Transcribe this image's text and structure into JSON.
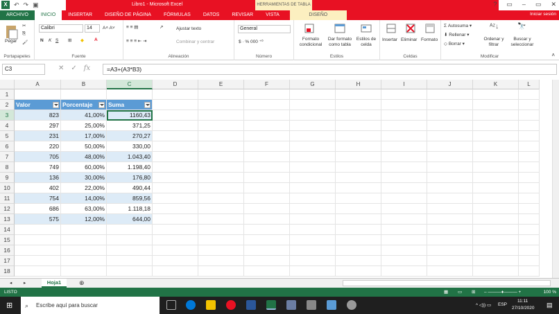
{
  "title": {
    "text": "Libro1 - Microsoft Excel",
    "context": "HERRAMIENTAS DE TABLA",
    "signin": "Iniciar sesión"
  },
  "tabs": [
    "ARCHIVO",
    "INICIO",
    "INSERTAR",
    "DISEÑO DE PÁGINA",
    "FÓRMULAS",
    "DATOS",
    "REVISAR",
    "VISTA",
    "DISEÑO"
  ],
  "ribbon": {
    "paste": "Pegar",
    "font": "Calibri",
    "size": "14",
    "wrap": "Ajustar texto",
    "merge": "Combinar y centrar",
    "numfmt": "General",
    "cond": "Formato condicional",
    "astable": "Dar formato como tabla",
    "styles": "Estilos de celda",
    "insert": "Insertar",
    "delete": "Eliminar",
    "format": "Formato",
    "autosum": "Autosuma",
    "fill": "Rellenar",
    "clear": "Borrar",
    "sort": "Ordenar y filtrar",
    "find": "Buscar y seleccionar",
    "groups": [
      "Portapapeles",
      "Fuente",
      "Alineación",
      "Número",
      "Estilos",
      "Celdas",
      "Modificar"
    ]
  },
  "formula_bar": {
    "namebox": "C3",
    "fx": "fx",
    "formula": "=A3+(A3*B3)"
  },
  "columns": [
    "A",
    "B",
    "C",
    "D",
    "E",
    "F",
    "G",
    "H",
    "I",
    "J",
    "K",
    "L"
  ],
  "rows": [
    "1",
    "2",
    "3",
    "4",
    "5",
    "6",
    "7",
    "8",
    "9",
    "10",
    "11",
    "12",
    "13",
    "14",
    "15",
    "16",
    "17",
    "18"
  ],
  "table": {
    "headers": [
      "Valor",
      "Porcentaje",
      "Suma"
    ],
    "data": [
      [
        "823",
        "41,00%",
        "1160,43"
      ],
      [
        "297",
        "25,00%",
        "371,25"
      ],
      [
        "231",
        "17,00%",
        "270,27"
      ],
      [
        "220",
        "50,00%",
        "330,00"
      ],
      [
        "705",
        "48,00%",
        "1.043,40"
      ],
      [
        "749",
        "60,00%",
        "1.198,40"
      ],
      [
        "136",
        "30,00%",
        "176,80"
      ],
      [
        "402",
        "22,00%",
        "490,44"
      ],
      [
        "754",
        "14,00%",
        "859,56"
      ],
      [
        "686",
        "63,00%",
        "1.118,18"
      ],
      [
        "575",
        "12,00%",
        "644,00"
      ]
    ]
  },
  "sheet": {
    "name": "Hoja1"
  },
  "status": {
    "left": "LISTO",
    "zoom": "100 %"
  },
  "taskbar": {
    "search": "Escribe aquí para buscar",
    "lang": "ESP",
    "time": "11:11",
    "date": "27/10/2020"
  }
}
